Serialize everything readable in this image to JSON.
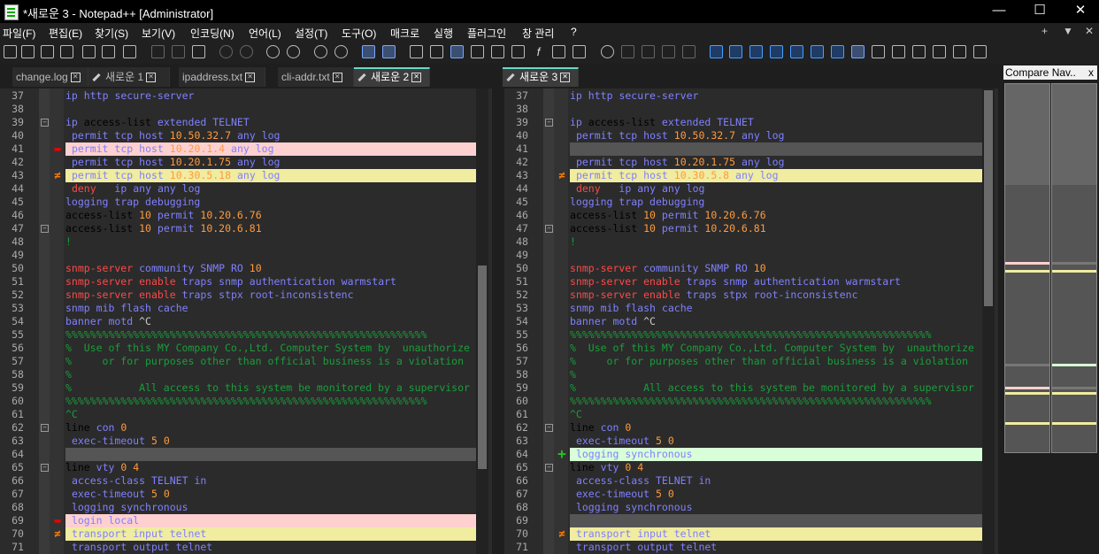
{
  "window": {
    "title": "*새로운 3 - Notepad++ [Administrator]",
    "min": "—",
    "max": "☐",
    "close": "✕"
  },
  "menu": [
    "파일(F)",
    "편집(E)",
    "찾기(S)",
    "보기(V)",
    "인코딩(N)",
    "언어(L)",
    "설정(T)",
    "도구(O)",
    "매크로",
    "실행",
    "플러그인",
    "창 관리",
    "?"
  ],
  "menu_right": [
    "+",
    "▼",
    "✕"
  ],
  "left_tabs": [
    {
      "label": "change.log",
      "active": false,
      "pencil": false
    },
    {
      "label": "새로운 1",
      "active": false,
      "pencil": true
    },
    {
      "label": "ipaddress.txt",
      "active": false,
      "pencil": false
    },
    {
      "label": "cli-addr.txt",
      "active": false,
      "pencil": false
    },
    {
      "label": "새로운 2",
      "active": true,
      "pencil": true
    }
  ],
  "right_tabs": [
    {
      "label": "새로운 3",
      "active": true,
      "pencil": true
    }
  ],
  "panel": {
    "title": "Compare Nav..",
    "close": "x"
  },
  "colors": {
    "removed": "#ffd0d0",
    "changed": "#f0eca0",
    "added": "#d8ffd8",
    "keyword": "#8080ff",
    "number": "#ff9b3d",
    "comment": "#1a9e3a",
    "error": "#ff4848"
  },
  "left_lines": [
    {
      "n": "37",
      "t": "ip http secure-server",
      "m": ""
    },
    {
      "n": "38",
      "t": "",
      "m": ""
    },
    {
      "n": "39",
      "t": "ip access-list extended TELNET",
      "m": "",
      "fold": true
    },
    {
      "n": "40",
      "t": " permit tcp host 10.50.32.7 any log",
      "m": ""
    },
    {
      "n": "41",
      "t": " permit tcp host 10.20.1.4 any log",
      "m": "rem"
    },
    {
      "n": "42",
      "t": " permit tcp host 10.20.1.75 any log",
      "m": ""
    },
    {
      "n": "43",
      "t": " permit tcp host 10.30.5.18 any log",
      "m": "chg"
    },
    {
      "n": "44",
      "t": " deny   ip any any log",
      "m": ""
    },
    {
      "n": "45",
      "t": "logging trap debugging",
      "m": ""
    },
    {
      "n": "46",
      "t": "access-list 10 permit 10.20.6.76",
      "m": ""
    },
    {
      "n": "47",
      "t": "access-list 10 permit 10.20.6.81",
      "m": "",
      "fold": true
    },
    {
      "n": "48",
      "t": "!",
      "m": ""
    },
    {
      "n": "49",
      "t": "",
      "m": ""
    },
    {
      "n": "50",
      "t": "snmp-server community SNMP RO 10",
      "m": ""
    },
    {
      "n": "51",
      "t": "snmp-server enable traps snmp authentication warmstart",
      "m": ""
    },
    {
      "n": "52",
      "t": "snmp-server enable traps stpx root-inconsistenc",
      "m": ""
    },
    {
      "n": "53",
      "t": "snmp mib flash cache",
      "m": ""
    },
    {
      "n": "54",
      "t": "banner motd ^C",
      "m": ""
    },
    {
      "n": "55",
      "t": "%%%%%%%%%%%%%%%%%%%%%%%%%%%%%%%%%%%%%%%%%%%%%%%%%%%%%%%%%%%",
      "m": ""
    },
    {
      "n": "56",
      "t": "%  Use of this MY Company Co.,Ltd. Computer System by  unauthorize",
      "m": ""
    },
    {
      "n": "57",
      "t": "%     or for purposes other than official business is a violation",
      "m": ""
    },
    {
      "n": "58",
      "t": "%",
      "m": ""
    },
    {
      "n": "59",
      "t": "%           All access to this system be monitored by a supervisor",
      "m": ""
    },
    {
      "n": "60",
      "t": "%%%%%%%%%%%%%%%%%%%%%%%%%%%%%%%%%%%%%%%%%%%%%%%%%%%%%%%%%%%",
      "m": ""
    },
    {
      "n": "61",
      "t": "^C",
      "m": ""
    },
    {
      "n": "62",
      "t": "line con 0",
      "m": "",
      "fold": true
    },
    {
      "n": "63",
      "t": " exec-timeout 5 0",
      "m": ""
    },
    {
      "n": "64",
      "t": "",
      "m": "ghost"
    },
    {
      "n": "65",
      "t": "line vty 0 4",
      "m": "",
      "fold": true
    },
    {
      "n": "66",
      "t": " access-class TELNET in",
      "m": ""
    },
    {
      "n": "67",
      "t": " exec-timeout 5 0",
      "m": ""
    },
    {
      "n": "68",
      "t": " logging synchronous",
      "m": ""
    },
    {
      "n": "69",
      "t": " login local",
      "m": "rem"
    },
    {
      "n": "70",
      "t": " transport input telnet",
      "m": "chg"
    },
    {
      "n": "71",
      "t": " transport output telnet",
      "m": ""
    }
  ],
  "right_lines": [
    {
      "n": "37",
      "t": "ip http secure-server",
      "m": ""
    },
    {
      "n": "38",
      "t": "",
      "m": ""
    },
    {
      "n": "39",
      "t": "ip access-list extended TELNET",
      "m": "",
      "fold": true
    },
    {
      "n": "40",
      "t": " permit tcp host 10.50.32.7 any log",
      "m": ""
    },
    {
      "n": "41",
      "t": "",
      "m": "ghost"
    },
    {
      "n": "42",
      "t": " permit tcp host 10.20.1.75 any log",
      "m": ""
    },
    {
      "n": "43",
      "t": " permit tcp host 10.30.5.8 any log",
      "m": "chg"
    },
    {
      "n": "44",
      "t": " deny   ip any any log",
      "m": ""
    },
    {
      "n": "45",
      "t": "logging trap debugging",
      "m": ""
    },
    {
      "n": "46",
      "t": "access-list 10 permit 10.20.6.76",
      "m": ""
    },
    {
      "n": "47",
      "t": "access-list 10 permit 10.20.6.81",
      "m": "",
      "fold": true
    },
    {
      "n": "48",
      "t": "!",
      "m": ""
    },
    {
      "n": "49",
      "t": "",
      "m": ""
    },
    {
      "n": "50",
      "t": "snmp-server community SNMP RO 10",
      "m": ""
    },
    {
      "n": "51",
      "t": "snmp-server enable traps snmp authentication warmstart",
      "m": ""
    },
    {
      "n": "52",
      "t": "snmp-server enable traps stpx root-inconsistenc",
      "m": ""
    },
    {
      "n": "53",
      "t": "snmp mib flash cache",
      "m": ""
    },
    {
      "n": "54",
      "t": "banner motd ^C",
      "m": ""
    },
    {
      "n": "55",
      "t": "%%%%%%%%%%%%%%%%%%%%%%%%%%%%%%%%%%%%%%%%%%%%%%%%%%%%%%%%%%%",
      "m": ""
    },
    {
      "n": "56",
      "t": "%  Use of this MY Company Co.,Ltd. Computer System by  unauthorize",
      "m": ""
    },
    {
      "n": "57",
      "t": "%     or for purposes other than official business is a violation",
      "m": ""
    },
    {
      "n": "58",
      "t": "%",
      "m": ""
    },
    {
      "n": "59",
      "t": "%           All access to this system be monitored by a supervisor",
      "m": ""
    },
    {
      "n": "60",
      "t": "%%%%%%%%%%%%%%%%%%%%%%%%%%%%%%%%%%%%%%%%%%%%%%%%%%%%%%%%%%%",
      "m": ""
    },
    {
      "n": "61",
      "t": "^C",
      "m": ""
    },
    {
      "n": "62",
      "t": "line con 0",
      "m": "",
      "fold": true
    },
    {
      "n": "63",
      "t": " exec-timeout 5 0",
      "m": ""
    },
    {
      "n": "64",
      "t": " logging synchronous",
      "m": "add"
    },
    {
      "n": "65",
      "t": "line vty 0 4",
      "m": "",
      "fold": true
    },
    {
      "n": "66",
      "t": " access-class TELNET in",
      "m": ""
    },
    {
      "n": "67",
      "t": " exec-timeout 5 0",
      "m": ""
    },
    {
      "n": "68",
      "t": " logging synchronous",
      "m": ""
    },
    {
      "n": "69",
      "t": "",
      "m": "ghost"
    },
    {
      "n": "70",
      "t": " transport input telnet",
      "m": "chg"
    },
    {
      "n": "71",
      "t": " transport output telnet",
      "m": ""
    }
  ]
}
